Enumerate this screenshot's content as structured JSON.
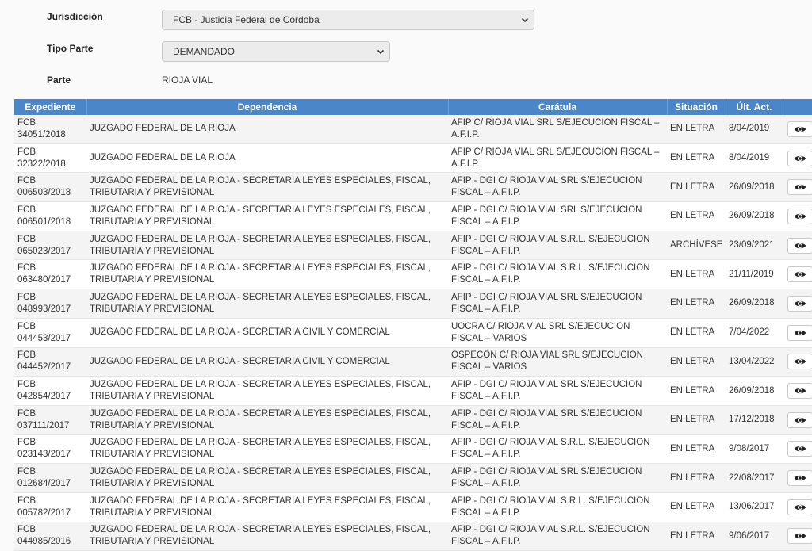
{
  "filters": {
    "jurisdiccion": {
      "label": "Jurisdicción",
      "value": "FCB - Justicia Federal de Córdoba"
    },
    "tipo_parte": {
      "label": "Tipo Parte",
      "value": "DEMANDADO"
    },
    "parte": {
      "label": "Parte",
      "value": "RIOJA VIAL"
    }
  },
  "table": {
    "headers": [
      "Expediente",
      "Dependencia",
      "Carátula",
      "Situación",
      "Últ. Act."
    ],
    "rows": [
      {
        "exp_a": "FCB",
        "exp_b": "34051/2018",
        "dependencia": "JUZGADO FEDERAL DE LA RIOJA",
        "caratula": "AFIP C/ RIOJA VIAL SRL S/EJECUCION FISCAL – A.F.I.P.",
        "situacion": "EN LETRA",
        "ult_act": "8/04/2019"
      },
      {
        "exp_a": "FCB",
        "exp_b": "32322/2018",
        "dependencia": "JUZGADO FEDERAL DE LA RIOJA",
        "caratula": "AFIP C/ RIOJA VIAL SRL S/EJECUCION FISCAL – A.F.I.P.",
        "situacion": "EN LETRA",
        "ult_act": "8/04/2019"
      },
      {
        "exp_a": "FCB",
        "exp_b": "006503/2018",
        "dependencia": "JUZGADO FEDERAL DE LA RIOJA - SECRETARIA LEYES ESPECIALES, FISCAL, TRIBUTARIA Y PREVISIONAL",
        "caratula": "AFIP - DGI C/ RIOJA VIAL SRL S/EJECUCION FISCAL – A.F.I.P.",
        "situacion": "EN LETRA",
        "ult_act": "26/09/2018"
      },
      {
        "exp_a": "FCB",
        "exp_b": "006501/2018",
        "dependencia": "JUZGADO FEDERAL DE LA RIOJA - SECRETARIA LEYES ESPECIALES, FISCAL, TRIBUTARIA Y PREVISIONAL",
        "caratula": "AFIP - DGI C/ RIOJA VIAL SRL S/EJECUCION FISCAL – A.F.I.P.",
        "situacion": "EN LETRA",
        "ult_act": "26/09/2018"
      },
      {
        "exp_a": "FCB",
        "exp_b": "065023/2017",
        "dependencia": "JUZGADO FEDERAL DE LA RIOJA - SECRETARIA LEYES ESPECIALES, FISCAL, TRIBUTARIA Y PREVISIONAL",
        "caratula": "AFIP - DGI C/ RIOJA VIAL S.R.L. S/EJECUCION FISCAL – A.F.I.P.",
        "situacion": "ARCHÍVESE",
        "ult_act": "23/09/2021"
      },
      {
        "exp_a": "FCB",
        "exp_b": "063480/2017",
        "dependencia": "JUZGADO FEDERAL DE LA RIOJA - SECRETARIA LEYES ESPECIALES, FISCAL, TRIBUTARIA Y PREVISIONAL",
        "caratula": "AFIP - DGI C/ RIOJA VIAL S.R.L. S/EJECUCION FISCAL – A.F.I.P.",
        "situacion": "EN LETRA",
        "ult_act": "21/11/2019"
      },
      {
        "exp_a": "FCB",
        "exp_b": "048993/2017",
        "dependencia": "JUZGADO FEDERAL DE LA RIOJA - SECRETARIA LEYES ESPECIALES, FISCAL, TRIBUTARIA Y PREVISIONAL",
        "caratula": "AFIP - DGI C/ RIOJA VIAL SRL S/EJECUCION FISCAL – A.F.I.P.",
        "situacion": "EN LETRA",
        "ult_act": "26/09/2018"
      },
      {
        "exp_a": "FCB",
        "exp_b": "044453/2017",
        "dependencia": "JUZGADO FEDERAL DE LA RIOJA - SECRETARIA CIVIL Y COMERCIAL",
        "caratula": "UOCRA C/ RIOJA VIAL SRL S/EJECUCION FISCAL – VARIOS",
        "situacion": "EN LETRA",
        "ult_act": "7/04/2022"
      },
      {
        "exp_a": "FCB",
        "exp_b": "044452/2017",
        "dependencia": "JUZGADO FEDERAL DE LA RIOJA - SECRETARIA CIVIL Y COMERCIAL",
        "caratula": "OSPECON C/ RIOJA VIAL SRL S/EJECUCION FISCAL – VARIOS",
        "situacion": "EN LETRA",
        "ult_act": "13/04/2022"
      },
      {
        "exp_a": "FCB",
        "exp_b": "042854/2017",
        "dependencia": "JUZGADO FEDERAL DE LA RIOJA - SECRETARIA LEYES ESPECIALES, FISCAL, TRIBUTARIA Y PREVISIONAL",
        "caratula": "AFIP - DGI C/ RIOJA VIAL SRL S/EJECUCION FISCAL – A.F.I.P.",
        "situacion": "EN LETRA",
        "ult_act": "26/09/2018"
      },
      {
        "exp_a": "FCB",
        "exp_b": "037111/2017",
        "dependencia": "JUZGADO FEDERAL DE LA RIOJA - SECRETARIA LEYES ESPECIALES, FISCAL, TRIBUTARIA Y PREVISIONAL",
        "caratula": "AFIP - DGI C/ RIOJA VIAL SRL S/EJECUCION FISCAL – A.F.I.P.",
        "situacion": "EN LETRA",
        "ult_act": "17/12/2018"
      },
      {
        "exp_a": "FCB",
        "exp_b": "023143/2017",
        "dependencia": "JUZGADO FEDERAL DE LA RIOJA - SECRETARIA LEYES ESPECIALES, FISCAL, TRIBUTARIA Y PREVISIONAL",
        "caratula": "AFIP - DGI C/ RIOJA VIAL S.R.L. S/EJECUCION FISCAL – A.F.I.P.",
        "situacion": "EN LETRA",
        "ult_act": "9/08/2017"
      },
      {
        "exp_a": "FCB",
        "exp_b": "012684/2017",
        "dependencia": "JUZGADO FEDERAL DE LA RIOJA - SECRETARIA LEYES ESPECIALES, FISCAL, TRIBUTARIA Y PREVISIONAL",
        "caratula": "AFIP - DGI C/ RIOJA VIAL SRL S/EJECUCION FISCAL – A.F.I.P.",
        "situacion": "EN LETRA",
        "ult_act": "22/08/2017"
      },
      {
        "exp_a": "FCB",
        "exp_b": "005782/2017",
        "dependencia": "JUZGADO FEDERAL DE LA RIOJA - SECRETARIA LEYES ESPECIALES, FISCAL, TRIBUTARIA Y PREVISIONAL",
        "caratula": "AFIP - DGI C/ RIOJA VIAL S.R.L. S/EJECUCION FISCAL – A.F.I.P.",
        "situacion": "EN LETRA",
        "ult_act": "13/06/2017"
      },
      {
        "exp_a": "FCB",
        "exp_b": "044985/2016",
        "dependencia": "JUZGADO FEDERAL DE LA RIOJA - SECRETARIA LEYES ESPECIALES, FISCAL, TRIBUTARIA Y PREVISIONAL",
        "caratula": "AFIP - DGI C/ RIOJA VIAL S.R.L. S/EJECUCION FISCAL – A.F.I.P.",
        "situacion": "EN LETRA",
        "ult_act": "9/06/2017"
      }
    ],
    "view_icon": "eye-icon"
  },
  "colors": {
    "header_bg": "#4a86c8",
    "row_alt_bg": "#f4f4f4",
    "page_bg": "#fafafa"
  }
}
